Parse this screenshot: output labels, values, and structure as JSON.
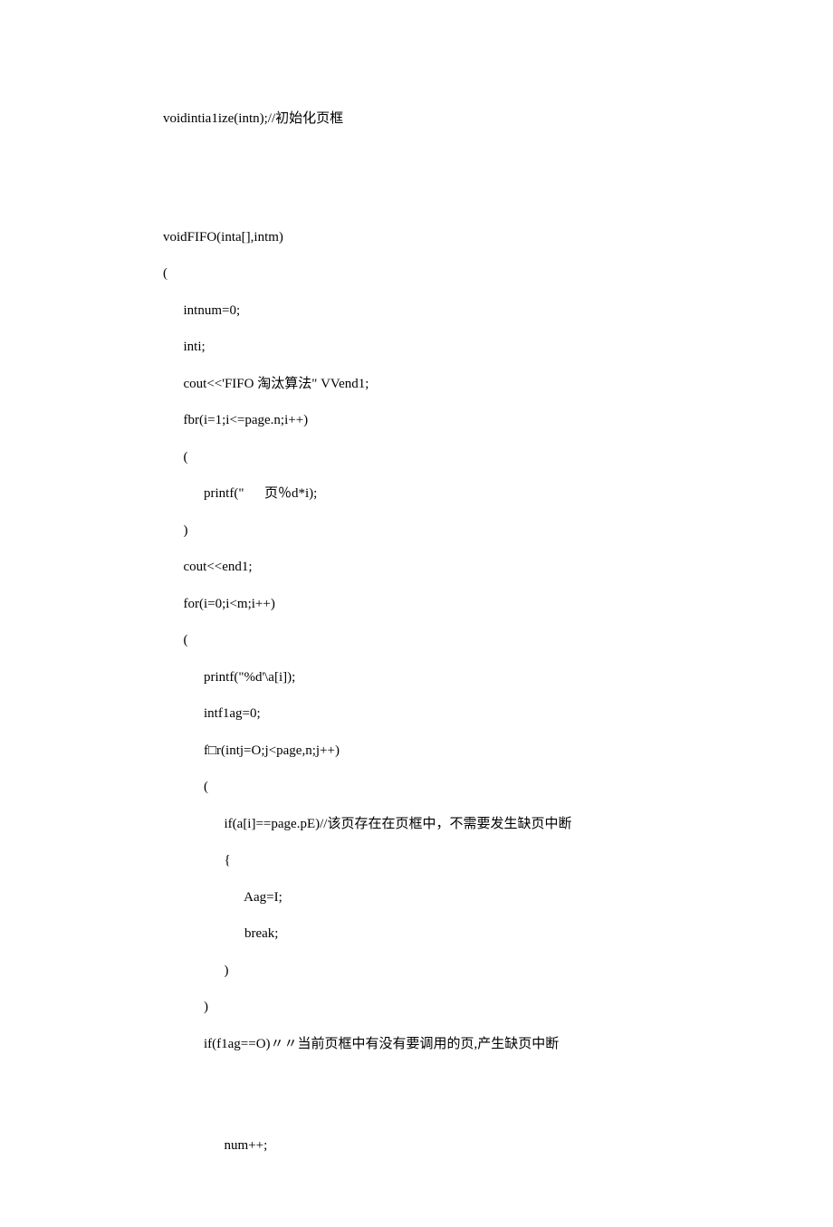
{
  "code": {
    "line1": "voidintia1ize(intn);//初始化页框",
    "line2": "voidFIFO(inta[],intm)",
    "line3": "(",
    "line4": "      intnum=0;",
    "line5": "      inti;",
    "line6": "      cout<<'FIFO 淘汰算法\" VVend1;",
    "line7": "      fbr(i=1;i<=page.n;i++)",
    "line8": "      (",
    "line9": "            printf(\"      页％d*i);",
    "line10": "      )",
    "line11": "      cout<<end1;",
    "line12": "      for(i=0;i<m;i++)",
    "line13": "      (",
    "line14": "            printf(\"%d'\\a[i]);",
    "line15": "            intf1ag=0;",
    "line16": "            f□r(intj=O;j<page,n;j++)",
    "line17": "            (",
    "line18": "                  if(a[i]==page.pE)//该页存在在页框中，不需要发生缺页中断",
    "line19": "                  {",
    "line20": "                        Aag=I;",
    "line21": "                        break;",
    "line22": "                  )",
    "line23": "            )",
    "line24": "            if(f1ag==O)〃〃当前页框中有没有要调用的页,产生缺页中断",
    "line25": "                  num++;"
  }
}
